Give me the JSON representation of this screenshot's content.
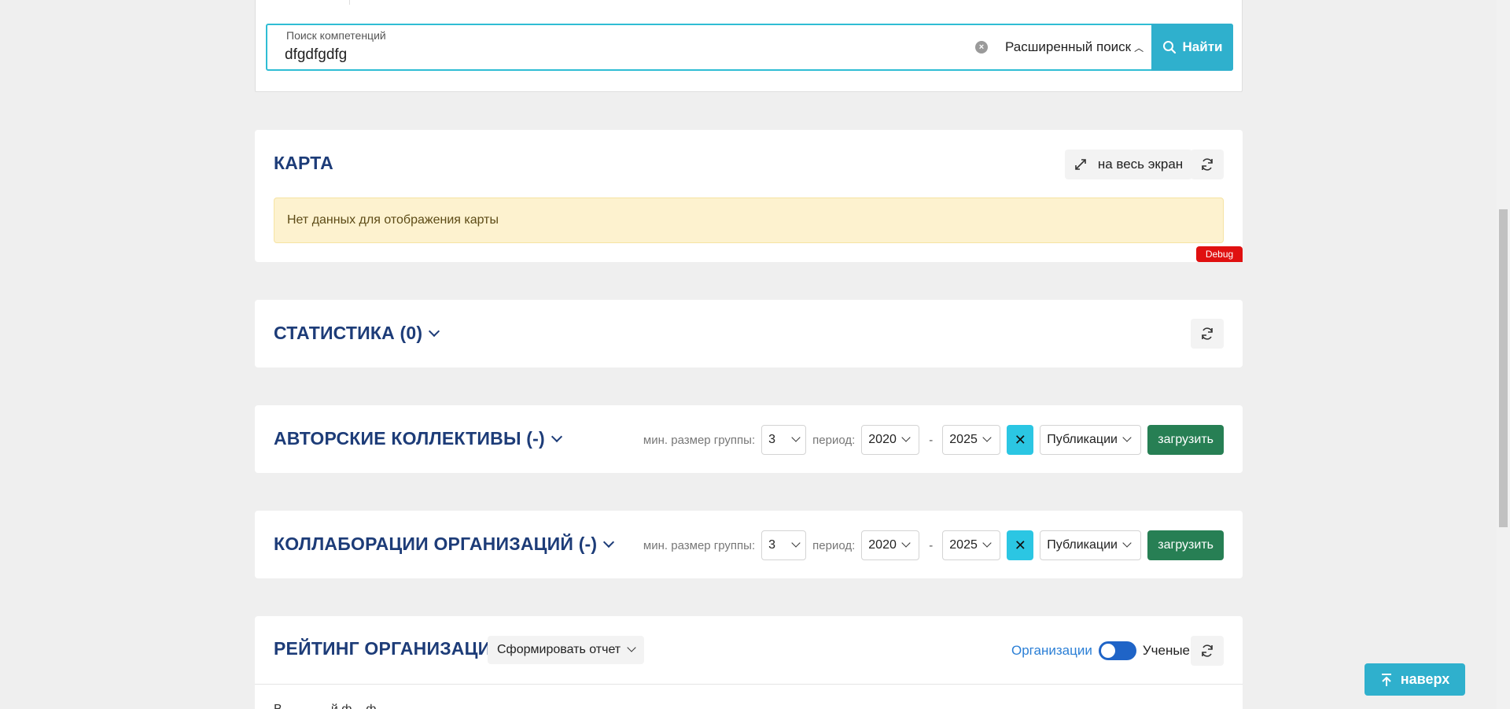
{
  "search": {
    "label": "Поиск компетенций",
    "value": "dfgdfgdfg",
    "advanced_label": "Расширенный поиск",
    "find_label": "Найти"
  },
  "map": {
    "title": "КАРТА",
    "fullscreen_label": "на весь экран",
    "empty_message": "Нет данных для отображения карты",
    "debug_label": "Debug"
  },
  "stats": {
    "title": "СТАТИСТИКА (0)"
  },
  "collectives": {
    "title": "АВТОРСКИЕ КОЛЛЕКТИВЫ (-)",
    "min_group_label": "мин. размер группы:",
    "min_group_value": "3",
    "period_label": "период:",
    "period_from": "2020",
    "period_sep": "-",
    "period_to": "2025",
    "clear_label": "✕",
    "type_value": "Публикации",
    "load_label": "загрузить"
  },
  "org_collab": {
    "title": "КОЛЛАБОРАЦИИ ОРГАНИЗАЦИЙ (-)",
    "min_group_label": "мин. размер группы:",
    "min_group_value": "3",
    "period_label": "период:",
    "period_from": "2020",
    "period_sep": "-",
    "period_to": "2025",
    "clear_label": "✕",
    "type_value": "Публикации",
    "load_label": "загрузить"
  },
  "rating": {
    "title": "РЕЙТИНГ ОРГАНИЗАЦИЙ",
    "report_label": "Сформировать отчет",
    "toggle_left": "Организации",
    "toggle_right": "Ученые",
    "subtitle": "В... ... ... ..й ф... ф..."
  },
  "scroll_top_label": "наверх",
  "colors": {
    "accent": "#2fb0cd",
    "title": "#1d3c78",
    "load_button": "#277f54",
    "debug": "#e01010",
    "alert_bg": "#fdf2cf"
  }
}
